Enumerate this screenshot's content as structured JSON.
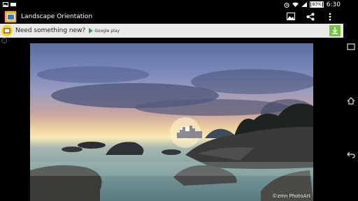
{
  "status_bar": {
    "battery": "83%",
    "time": "6:30",
    "icons": [
      "picture-icon",
      "notification-icon",
      "alarm-icon",
      "wifi-icon",
      "signal-icon",
      "battery-icon"
    ]
  },
  "action_bar": {
    "title": "Landscape Orientation",
    "icons": [
      "app-icon",
      "image-icon",
      "share-icon",
      "overflow-menu-icon"
    ]
  },
  "ad": {
    "text": "Need something new?",
    "store_label": "Google play",
    "icons": [
      "ad-logo-icon",
      "download-icon",
      "info-icon"
    ]
  },
  "photo": {
    "credit": "©zmn PhotoArt"
  },
  "nav_bar": {
    "icons": [
      "recent-apps-icon",
      "home-icon",
      "back-icon"
    ]
  },
  "colors": {
    "ad_background": "#e9e9e9",
    "download_green": "#7ac142",
    "bar_background": "#000000"
  }
}
